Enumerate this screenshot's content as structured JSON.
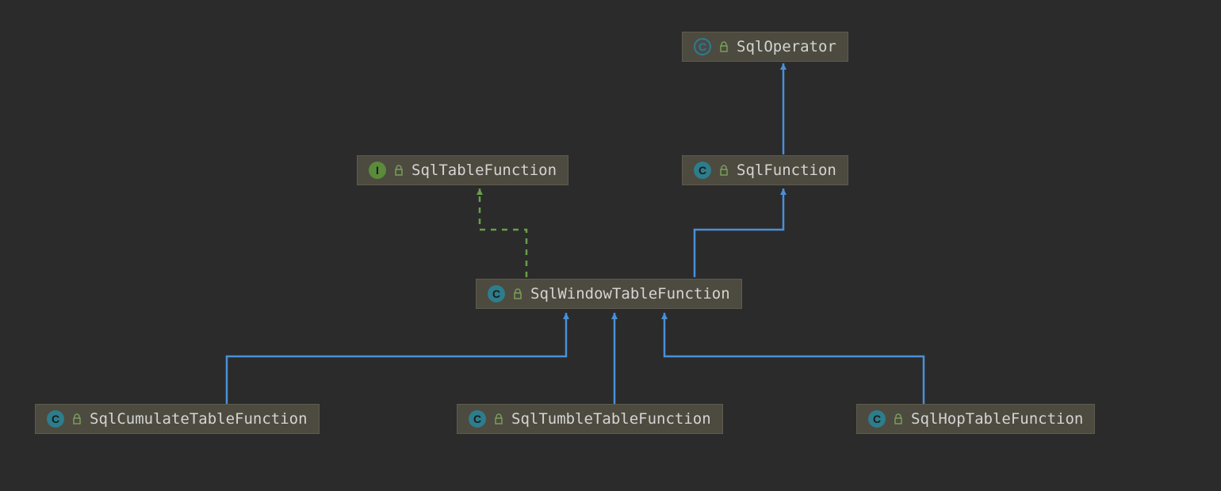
{
  "diagram": {
    "type": "class-hierarchy",
    "nodes": {
      "sqlOperator": {
        "label": "SqlOperator",
        "kind": "class-outline"
      },
      "sqlTableFunction": {
        "label": "SqlTableFunction",
        "kind": "interface"
      },
      "sqlFunction": {
        "label": "SqlFunction",
        "kind": "class"
      },
      "sqlWindowTableFunction": {
        "label": "SqlWindowTableFunction",
        "kind": "class"
      },
      "sqlCumulateTableFunction": {
        "label": "SqlCumulateTableFunction",
        "kind": "class"
      },
      "sqlTumbleTableFunction": {
        "label": "SqlTumbleTableFunction",
        "kind": "class"
      },
      "sqlHopTableFunction": {
        "label": "SqlHopTableFunction",
        "kind": "class"
      }
    },
    "edges": [
      {
        "from": "sqlFunction",
        "to": "sqlOperator",
        "type": "extends"
      },
      {
        "from": "sqlWindowTableFunction",
        "to": "sqlFunction",
        "type": "extends"
      },
      {
        "from": "sqlWindowTableFunction",
        "to": "sqlTableFunction",
        "type": "implements"
      },
      {
        "from": "sqlCumulateTableFunction",
        "to": "sqlWindowTableFunction",
        "type": "extends"
      },
      {
        "from": "sqlTumbleTableFunction",
        "to": "sqlWindowTableFunction",
        "type": "extends"
      },
      {
        "from": "sqlHopTableFunction",
        "to": "sqlWindowTableFunction",
        "type": "extends"
      }
    ],
    "iconLetters": {
      "class": "C",
      "interface": "I",
      "class-outline": "C"
    }
  },
  "colors": {
    "extendsLine": "#4a90d9",
    "implementsLine": "#6a9e4a",
    "background": "#2b2b2b",
    "nodeBg": "#4d4a3f"
  }
}
